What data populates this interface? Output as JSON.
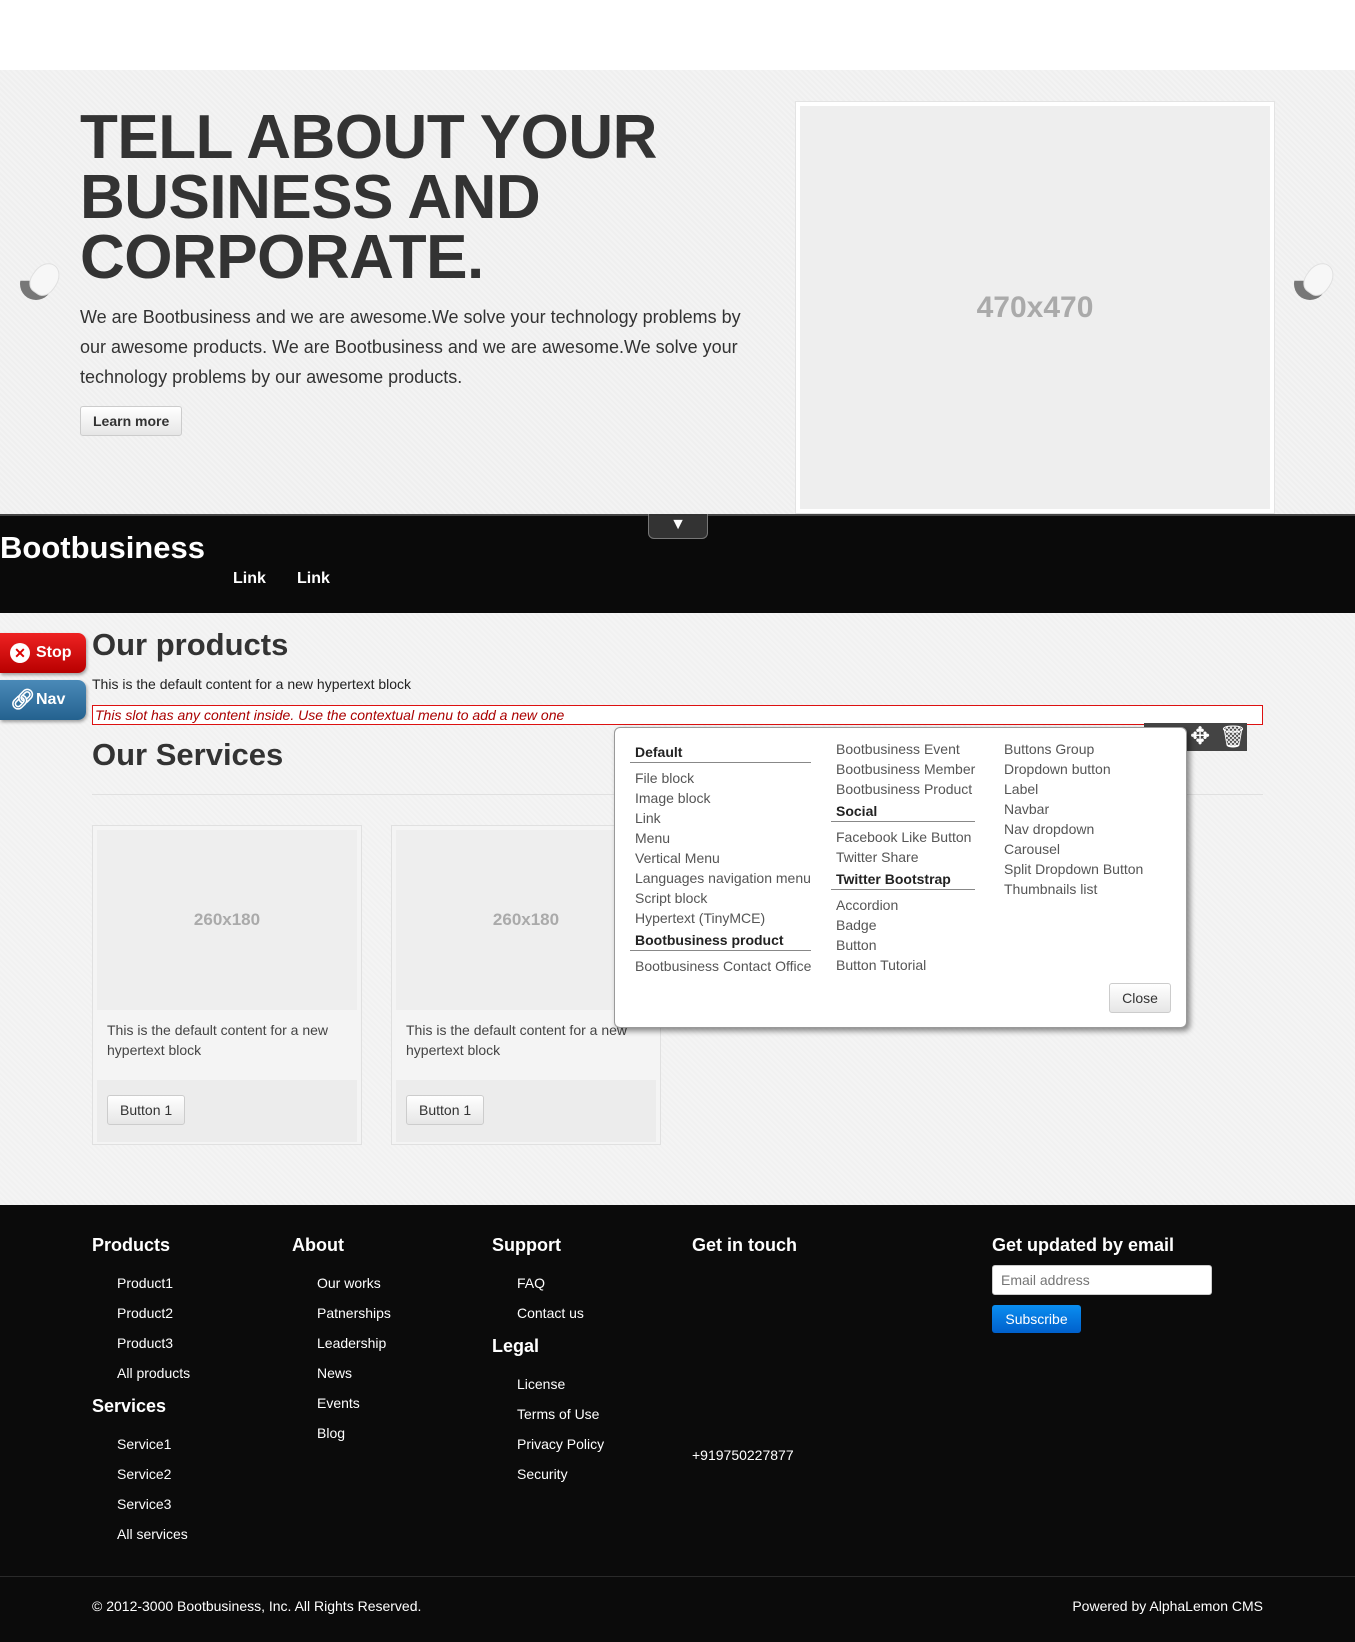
{
  "hero": {
    "title": "TELL ABOUT YOUR BUSINESS AND CORPORATE.",
    "text": "We are Bootbusiness and we are awesome.We solve your technology problems by our awesome products. We are Bootbusiness and we are awesome.We solve your technology problems by our awesome products.",
    "button": "Learn more",
    "image_placeholder": "470x470"
  },
  "navbar": {
    "toggle": "▼",
    "brand": "Bootbusiness",
    "links": [
      "Link",
      "Link"
    ]
  },
  "sidebar": {
    "stop": "Stop",
    "nav": "Nav"
  },
  "main": {
    "products_heading": "Our products",
    "products_text": "This is the default content for a new hypertext block",
    "slot_warning": "This slot has any content inside. Use the contextual menu to add a new one",
    "services_heading": "Our Services",
    "cards": [
      {
        "image": "260x180",
        "text": "This is the default content for a new hypertext block",
        "button": "Button 1"
      },
      {
        "image": "260x180",
        "text": "This is the default content for a new hypertext block",
        "button": "Button 1"
      }
    ]
  },
  "block_menu": {
    "col1": {
      "default_header": "Default",
      "default_items": [
        "File block",
        "Image block",
        "Link",
        "Menu",
        "Vertical Menu",
        "Languages navigation menu",
        "Script block",
        "Hypertext (TinyMCE)"
      ],
      "product_header": "Bootbusiness product",
      "product_items": [
        "Bootbusiness Contact Office"
      ]
    },
    "col2": {
      "top_items": [
        "Bootbusiness Event",
        "Bootbusiness Member",
        "Bootbusiness Product"
      ],
      "social_header": "Social",
      "social_items": [
        "Facebook Like Button",
        "Twitter Share"
      ],
      "tb_header": "Twitter Bootstrap",
      "tb_items": [
        "Accordion",
        "Badge",
        "Button",
        "Button Tutorial"
      ]
    },
    "col3": {
      "items": [
        "Buttons Group",
        "Dropdown button",
        "Label",
        "Navbar",
        "Nav dropdown",
        "Carousel",
        "Split Dropdown Button",
        "Thumbnails list"
      ]
    },
    "close": "Close"
  },
  "footer": {
    "products": {
      "heading": "Products",
      "items": [
        "Product1",
        "Product2",
        "Product3",
        "All products"
      ]
    },
    "services": {
      "heading": "Services",
      "items": [
        "Service1",
        "Service2",
        "Service3",
        "All services"
      ]
    },
    "about": {
      "heading": "About",
      "items": [
        "Our works",
        "Patnerships",
        "Leadership",
        "News",
        "Events",
        "Blog"
      ]
    },
    "support": {
      "heading": "Support",
      "items": [
        "FAQ",
        "Contact us"
      ]
    },
    "legal": {
      "heading": "Legal",
      "items": [
        "License",
        "Terms of Use",
        "Privacy Policy",
        "Security"
      ]
    },
    "contact": {
      "heading": "Get in touch",
      "phone": "+919750227877"
    },
    "newsletter": {
      "heading": "Get updated by email",
      "placeholder": "Email address",
      "button": "Subscribe"
    },
    "copyright": "© 2012-3000 Bootbusiness, Inc. All Rights Reserved.",
    "powered": "Powered by AlphaLemon CMS"
  },
  "colors": {
    "accent_blue": "#0a7ee8",
    "stop_red": "#d11",
    "nav_blue": "#2f6f9d"
  }
}
